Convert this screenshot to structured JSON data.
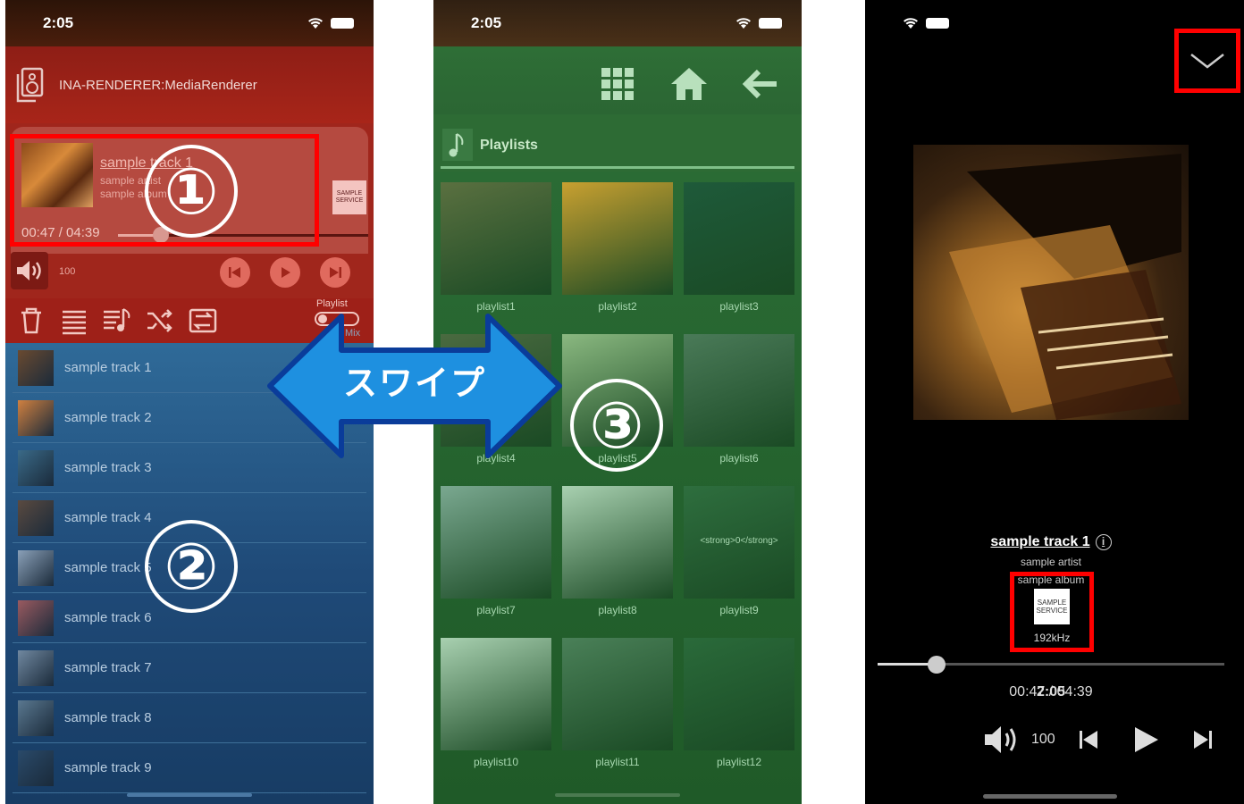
{
  "status_time": "2:05",
  "panel1": {
    "renderer": "INA-RENDERER:MediaRenderer",
    "now_playing": {
      "title": "sample track 1",
      "artist": "sample artist",
      "album": "sample album",
      "time": "00:47 / 04:39",
      "progress_fraction": 0.17,
      "service_logo": "SAMPLE SERVICE"
    },
    "volume": "100",
    "playlist_switch_label": "Playlist",
    "mix_label": "Mix",
    "tracks": [
      {
        "title": "sample track 1",
        "color": "#6a4a30"
      },
      {
        "title": "sample track 2",
        "color": "#d08040"
      },
      {
        "title": "sample track 3",
        "color": "#3a6a88"
      },
      {
        "title": "sample track 4",
        "color": "#5a4a40"
      },
      {
        "title": "sample track 5",
        "color": "#8aa0b8"
      },
      {
        "title": "sample track 6",
        "color": "#9a5a60"
      },
      {
        "title": "sample track 7",
        "color": "#7088a0"
      },
      {
        "title": "sample track 8",
        "color": "#5a7890"
      },
      {
        "title": "sample track 9",
        "color": "#2a4a6a"
      }
    ],
    "callouts": {
      "now_playing": "①",
      "list": "②"
    }
  },
  "swipe_label": "スワイプ",
  "panel2": {
    "section_title": "Playlists",
    "playlists": [
      {
        "label": "playlist1",
        "color": "#5a7040"
      },
      {
        "label": "playlist2",
        "color": "#c8a030"
      },
      {
        "label": "playlist3",
        "color": "#1e5a3a"
      },
      {
        "label": "playlist4",
        "color": "#4a6a40"
      },
      {
        "label": "playlist5",
        "color": "#8ab880"
      },
      {
        "label": "playlist6",
        "color": "#4a7a58"
      },
      {
        "label": "playlist7",
        "color": "#7aa890"
      },
      {
        "label": "playlist8",
        "color": "#a8d0b0"
      },
      {
        "label": "playlist9",
        "color": "#2e6e3e"
      },
      {
        "label": "playlist10",
        "color": "#a8d0b0"
      },
      {
        "label": "playlist11",
        "color": "#4a8058"
      },
      {
        "label": "playlist12",
        "color": "#2a6a3a"
      }
    ],
    "tile9_text": "<strong>0</strong>",
    "callout": "③"
  },
  "panel3": {
    "title": "sample track 1",
    "info_icon": "i",
    "artist": "sample artist",
    "album": "sample album",
    "service_logo": "SAMPLE SERVICE",
    "sample_rate": "192kHz",
    "progress_fraction": 0.17,
    "time": "00:47 / 04:39",
    "volume": "100"
  },
  "colors": {
    "highlight": "#ff0000",
    "arrow_fill": "#1e90e0",
    "arrow_stroke": "#0a3c9a"
  }
}
